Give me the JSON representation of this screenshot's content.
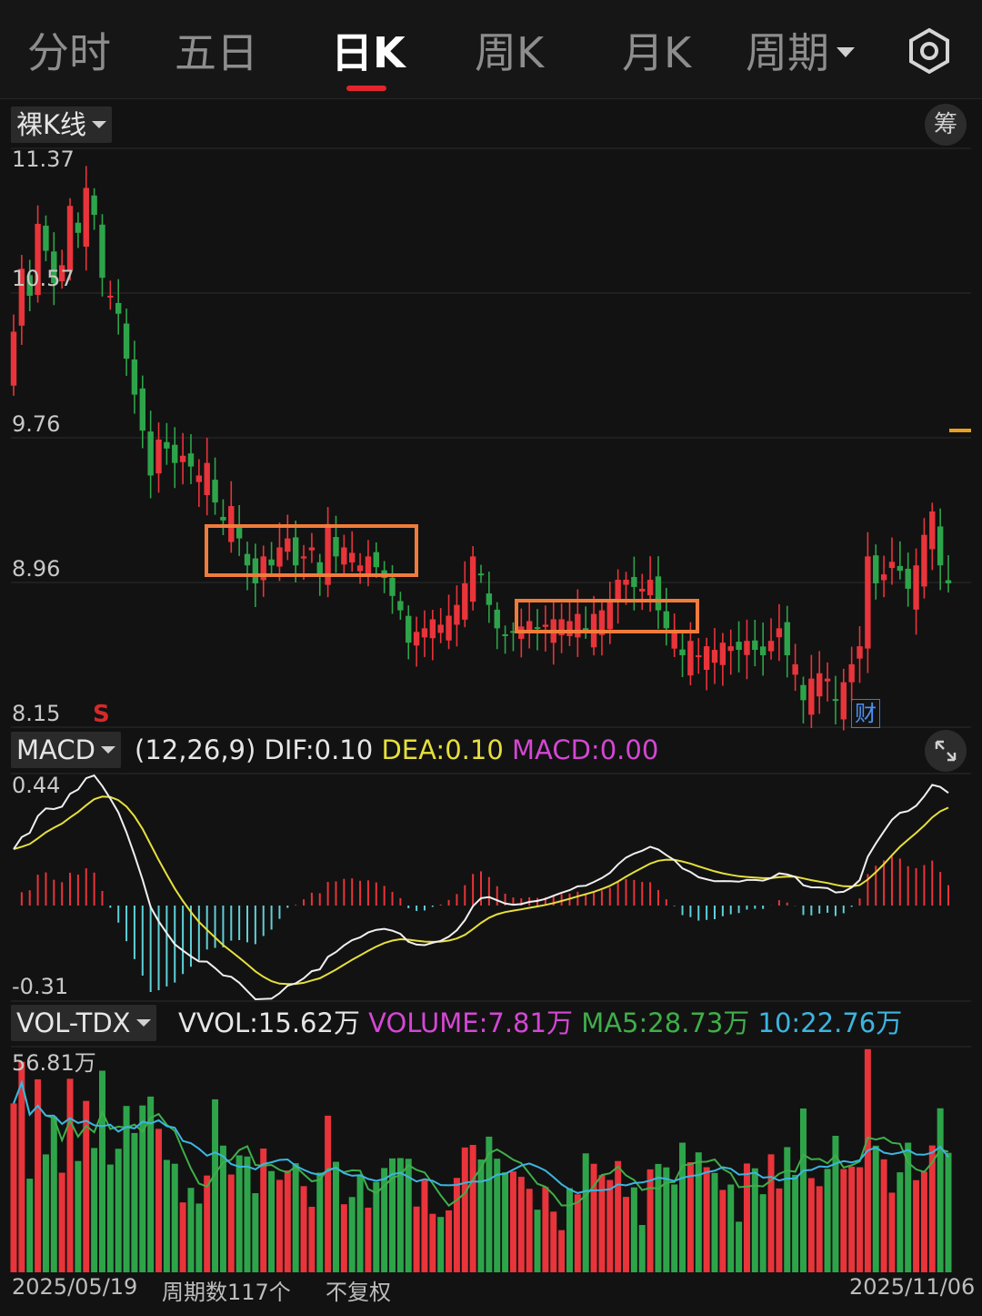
{
  "tabs": [
    {
      "label": "分时",
      "active": false
    },
    {
      "label": "五日",
      "active": false
    },
    {
      "label": "日K",
      "active": true
    },
    {
      "label": "周K",
      "active": false
    },
    {
      "label": "月K",
      "active": false
    },
    {
      "label": "周期",
      "active": false,
      "dropdown": true
    }
  ],
  "settings_icon": "gear-icon",
  "kline": {
    "mode_label": "裸K线",
    "chips_button": "筹",
    "price_ticks": [
      "11.37",
      "10.57",
      "9.76",
      "8.96",
      "8.15"
    ],
    "sell_marker": "S",
    "finance_marker": "财",
    "colors": {
      "up": "#e8343a",
      "down": "#2ea44a",
      "highlight_box": "#f07c3c",
      "marker": "#e8a020"
    }
  },
  "macd": {
    "name": "MACD",
    "params": "(12,26,9)",
    "dif_label": "DIF:",
    "dif_value": "0.10",
    "dea_label": "DEA:",
    "dea_value": "0.10",
    "macd_label": "MACD:",
    "macd_value": "0.00",
    "ticks": [
      "0.44",
      "-0.31"
    ],
    "expand_icon": "expand-icon"
  },
  "volume": {
    "name": "VOL-TDX",
    "vvol_label": "VVOL:",
    "vvol_value": "15.62万",
    "volume_label": "VOLUME:",
    "volume_value": "7.81万",
    "ma5_label": "MA5:",
    "ma5_value": "28.73万",
    "ma10_label": "10:",
    "ma10_value": "22.76万",
    "max_tick": "56.81万"
  },
  "footer": {
    "start_date": "2025/05/19",
    "period_count": "周期数117个",
    "adjust": "不复权",
    "end_date": "2025/11/06"
  },
  "chart_data": {
    "type": "candlestick",
    "price_axis": {
      "max": 11.37,
      "min": 8.15
    },
    "x_range": [
      "2025/05/19",
      "2025/11/06"
    ],
    "closes": [
      10.35,
      10.7,
      10.55,
      10.95,
      10.8,
      10.62,
      10.72,
      11.05,
      10.9,
      11.15,
      11.0,
      10.65,
      10.55,
      10.45,
      10.2,
      10.0,
      9.8,
      9.55,
      9.75,
      9.7,
      9.62,
      9.66,
      9.6,
      9.55,
      9.62,
      9.4,
      9.3,
      9.38,
      9.2,
      9.05,
      8.95,
      9.1,
      9.05,
      9.15,
      9.2,
      9.05,
      9.1,
      9.15,
      9.0,
      9.28,
      9.1,
      9.15,
      9.12,
      9.05,
      9.1,
      9.04,
      8.98,
      8.88,
      8.8,
      8.62,
      8.68,
      8.7,
      8.75,
      8.72,
      8.77,
      8.83,
      8.95,
      9.1,
      9.0,
      8.83,
      8.7,
      8.66,
      8.68,
      8.71,
      8.74,
      8.7,
      8.72,
      8.75,
      8.75,
      8.74,
      8.78,
      8.7,
      8.78,
      8.8,
      8.85,
      8.97,
      8.97,
      8.93,
      8.92,
      8.97,
      8.8,
      8.7,
      8.68,
      8.55,
      8.63,
      8.55,
      8.6,
      8.58,
      8.62,
      8.6,
      8.58,
      8.63,
      8.58,
      8.55,
      8.63,
      8.7,
      8.55,
      8.5,
      8.3,
      8.42,
      8.45,
      8.42,
      8.3,
      8.4,
      8.5,
      8.6,
      9.1,
      8.95,
      9.0,
      9.07,
      9.02,
      8.92,
      9.05,
      9.22,
      9.35,
      9.05,
      8.95
    ],
    "macd_axis": {
      "max": 0.44,
      "min": -0.31
    },
    "macd_summary": {
      "DIF": 0.1,
      "DEA": 0.1,
      "MACD": 0.0
    },
    "volume_axis_max_wan": 56.81,
    "volume_summary_wan": {
      "VVOL": 15.62,
      "VOLUME": 7.81,
      "MA5": 28.73,
      "MA10": 22.76
    }
  }
}
